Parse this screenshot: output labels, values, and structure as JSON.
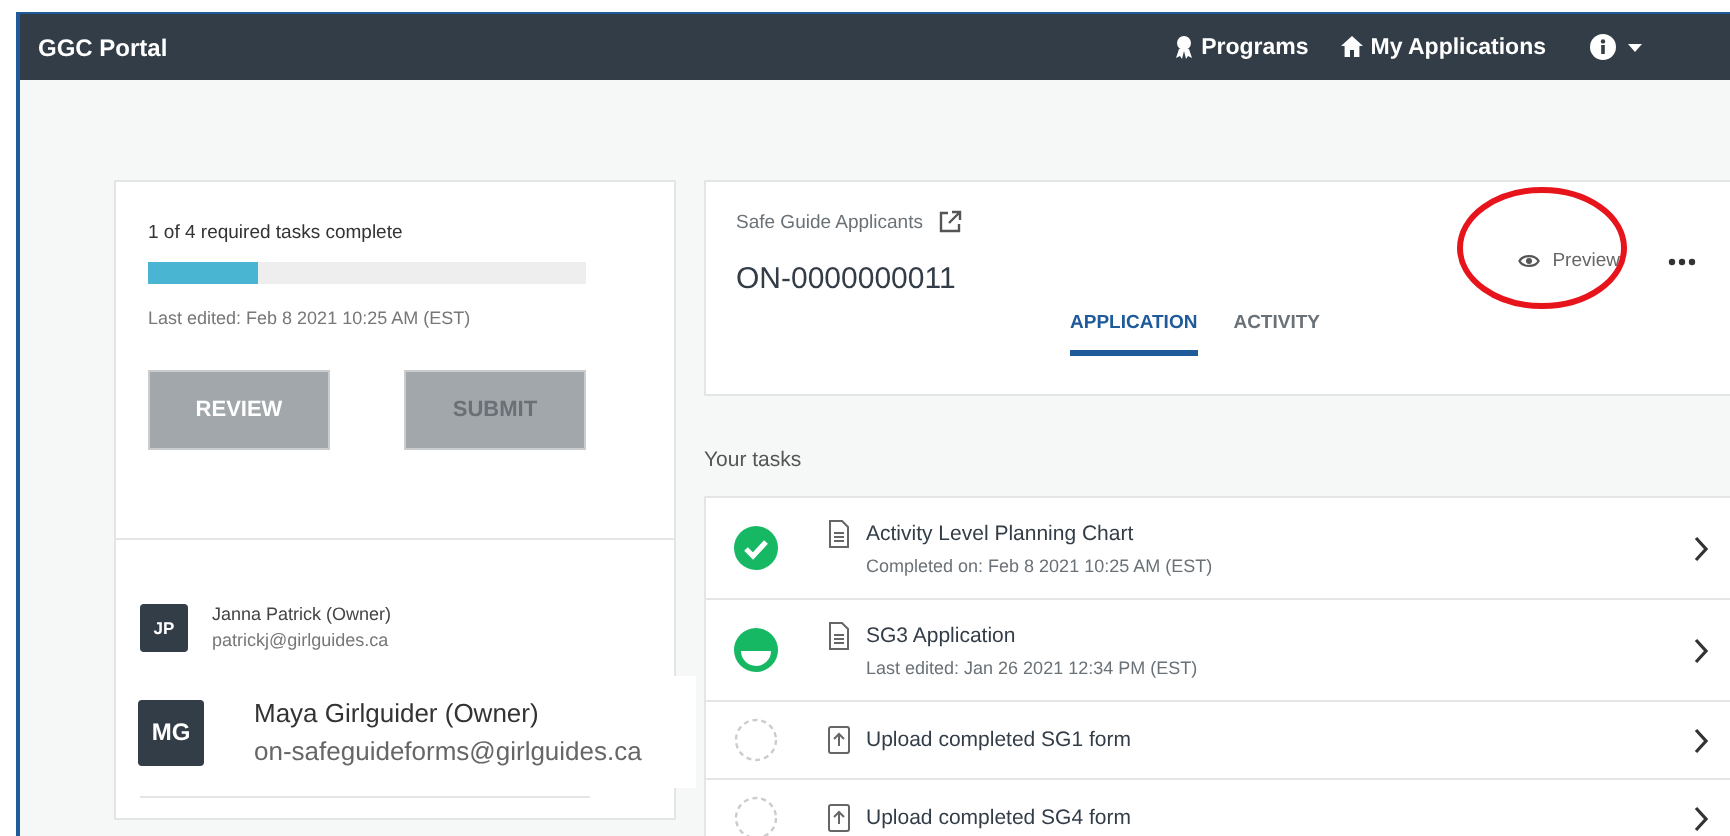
{
  "navbar": {
    "brand": "GGC Portal",
    "links": [
      {
        "kind": "programs",
        "label": "Programs"
      },
      {
        "kind": "home",
        "label": "My Applications"
      }
    ],
    "info_menu": {
      "expanded": false
    }
  },
  "summary": {
    "progress_text": "1 of 4 required tasks complete",
    "level": 0.25,
    "last_edited": "Last edited: Feb 8 2021 10:25 AM (EST)",
    "buttons": [
      {
        "label": "REVIEW",
        "disabled": false
      },
      {
        "label": "SUBMIT",
        "disabled": true
      }
    ]
  },
  "owners": [
    {
      "initials": "JP",
      "name": "Janna Patrick (Owner)",
      "email": "patrickj@girlguides.ca"
    }
  ],
  "owner_popup": {
    "initials": "MG",
    "name": "Maya Girlguider (Owner)",
    "email": "on-safeguideforms@girlguides.ca"
  },
  "application": {
    "program": "Safe Guide Applicants",
    "number": "ON-0000000011",
    "preview": "Preview",
    "tabs": [
      {
        "label": "APPLICATION",
        "selected": true
      },
      {
        "label": "ACTIVITY",
        "selected": false
      }
    ]
  },
  "annotation": {
    "kind": "circle"
  },
  "tasks_heading": "Your tasks",
  "tasks": [
    {
      "kind": "complete",
      "title": "Activity Level Planning Chart",
      "detail": "Completed on: Feb 8 2021 10:25 AM (EST)"
    },
    {
      "kind": "in_progress",
      "title": "SG3 Application",
      "detail": "Last edited: Jan 26 2021 12:34 PM (EST)"
    },
    {
      "kind": "not_started",
      "title": "Upload completed SG1 form"
    },
    {
      "kind": "not_started",
      "title": "Upload completed SG4 form"
    }
  ]
}
